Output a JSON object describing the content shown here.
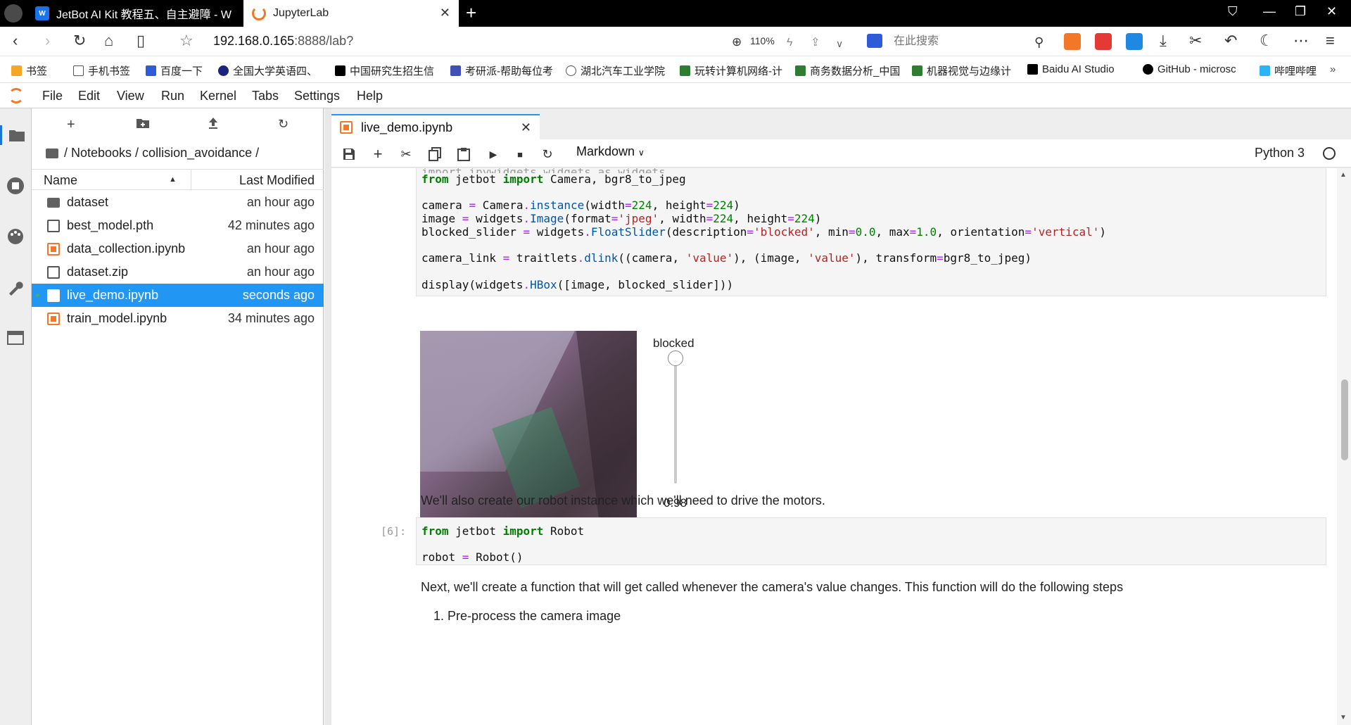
{
  "browser": {
    "tabs": [
      {
        "title": "JetBot AI Kit 教程五、自主避障 - W",
        "favicon": "wa-icon"
      },
      {
        "title": "JupyterLab",
        "favicon": "jupyter-icon"
      }
    ],
    "url_host": "192.168.0.165",
    "url_rest": ":8888/lab?",
    "zoom": "110%",
    "search_placeholder": "在此搜索",
    "bookmarks": [
      "书签",
      "手机书签",
      "百度一下",
      "全国大学英语四、",
      "中国研究生招生信",
      "考研派-帮助每位考",
      "湖北汽车工业学院",
      "玩转计算机网络-计",
      "商务数据分析_中国",
      "机器视觉与边缘计",
      "Baidu AI Studio",
      "GitHub - microsc",
      "哔哩哔哩"
    ]
  },
  "menubar": [
    "File",
    "Edit",
    "View",
    "Run",
    "Kernel",
    "Tabs",
    "Settings",
    "Help"
  ],
  "filebrowser": {
    "breadcrumb": "/ Notebooks / collision_avoidance /",
    "col_name": "Name",
    "col_modified": "Last Modified",
    "files": [
      {
        "name": "dataset",
        "type": "folder",
        "modified": "an hour ago"
      },
      {
        "name": "best_model.pth",
        "type": "file",
        "modified": "42 minutes ago"
      },
      {
        "name": "data_collection.ipynb",
        "type": "notebook",
        "modified": "an hour ago"
      },
      {
        "name": "dataset.zip",
        "type": "file",
        "modified": "an hour ago"
      },
      {
        "name": "live_demo.ipynb",
        "type": "notebook",
        "modified": "seconds ago",
        "selected": true
      },
      {
        "name": "train_model.ipynb",
        "type": "notebook",
        "modified": "34 minutes ago"
      }
    ]
  },
  "notebook": {
    "tab_title": "live_demo.ipynb",
    "cell_type": "Markdown",
    "kernel": "Python 3",
    "cell1_prompt": "",
    "cell2_prompt": "[6]:",
    "widget": {
      "label": "blocked",
      "value": "0.98",
      "level": 0.98
    },
    "md1": "We'll also create our robot instance which we'll need to drive the motors.",
    "md2": "Next, we'll create a function that will get called whenever the camera's value changes. This function will do the following steps",
    "md3": "1. Pre-process the camera image"
  }
}
